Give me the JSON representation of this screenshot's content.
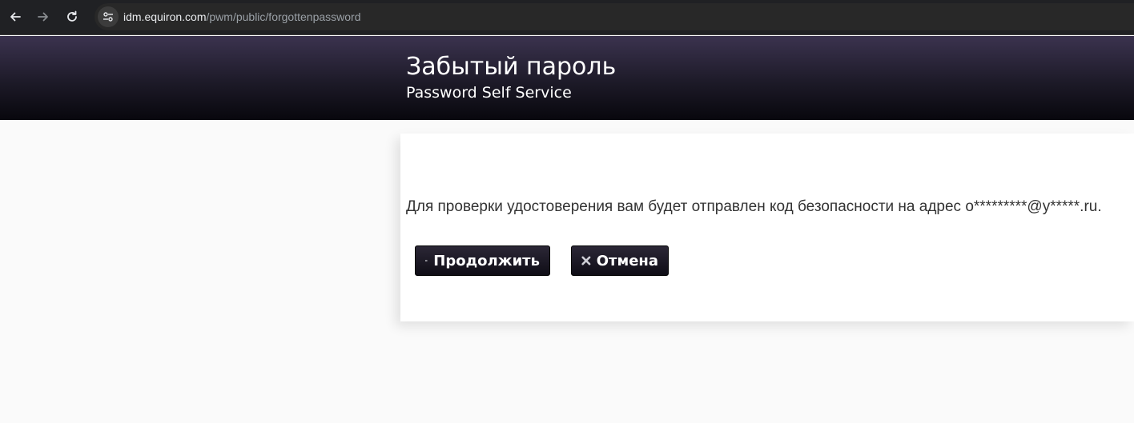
{
  "browser": {
    "url_host": "idm.equiron.com",
    "url_path": "/pwm/public/forgottenpassword",
    "icons": {
      "back": "back-arrow-icon",
      "forward": "forward-arrow-icon",
      "reload": "reload-icon",
      "site_info": "site-info-icon"
    }
  },
  "header": {
    "title": "Забытый пароль",
    "subtitle": "Password Self Service"
  },
  "panel": {
    "message": "Для проверки удостоверения вам будет отправлен код безопасности на адрес o*********@y*****.ru.",
    "continue_label": "Продолжить",
    "cancel_label": "Отмена"
  },
  "colors": {
    "header_top": "#3b334f",
    "header_bottom": "#08070d",
    "button": "#1a1722",
    "text": "#333333"
  }
}
